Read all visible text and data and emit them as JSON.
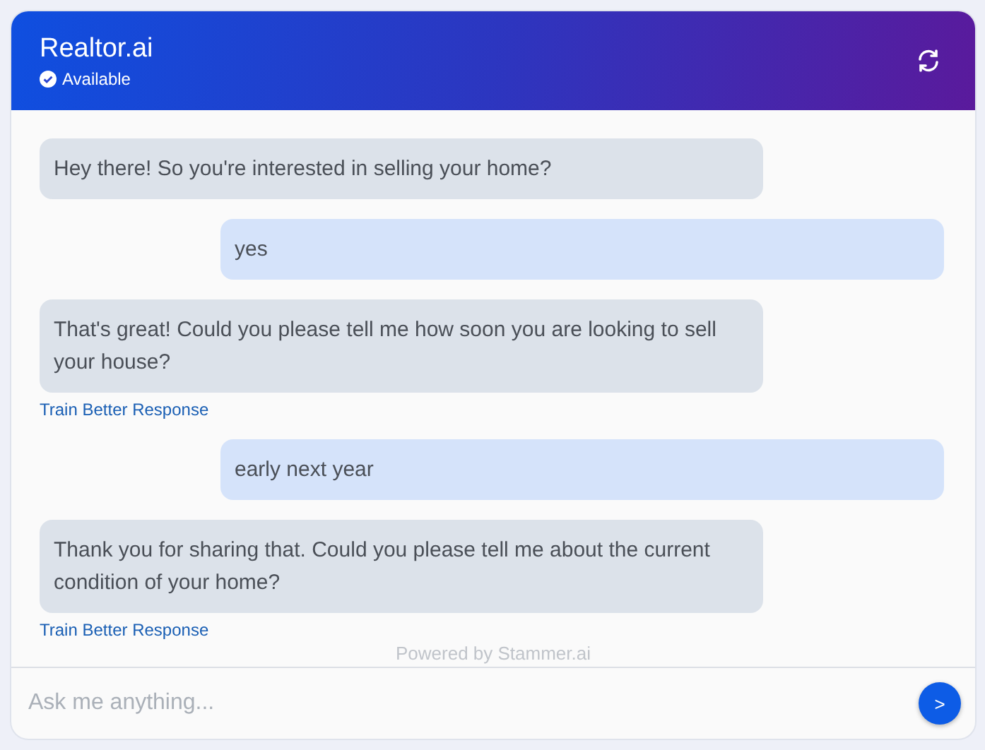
{
  "header": {
    "title": "Realtor.ai",
    "status": "Available"
  },
  "messages": [
    {
      "kind": "bot",
      "text": "Hey there! So you're interested in selling your home?"
    },
    {
      "kind": "user",
      "text": "yes"
    },
    {
      "kind": "bot",
      "text": "That's great! Could you please tell me how soon you are looking to sell your house?",
      "link": "Train Better Response"
    },
    {
      "kind": "user",
      "text": "early next year"
    },
    {
      "kind": "bot",
      "text": "Thank you for sharing that. Could you please tell me about the current condition of your home?",
      "link": "Train Better Response"
    }
  ],
  "footer": "Powered by Stammer.ai",
  "composer": {
    "placeholder": "Ask me anything...",
    "send": ">"
  }
}
